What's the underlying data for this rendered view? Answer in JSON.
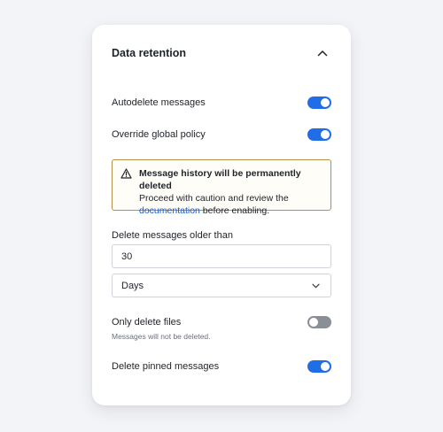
{
  "panel": {
    "title": "Data retention",
    "collapse_icon": "chevron-up-icon"
  },
  "settings": {
    "autodelete": {
      "label": "Autodelete messages",
      "enabled": true
    },
    "override_policy": {
      "label": "Override global policy",
      "enabled": true
    },
    "only_delete_files": {
      "label": "Only delete files",
      "enabled": false,
      "help": "Messages will not be deleted."
    },
    "delete_pinned": {
      "label": "Delete pinned messages",
      "enabled": true
    }
  },
  "warning": {
    "icon": "warning-triangle-icon",
    "title": "Message history will be permanently deleted",
    "body_prefix": "Proceed with caution and review the",
    "link_text": "documentation",
    "body_suffix": " before enabling."
  },
  "retention": {
    "label": "Delete messages older than",
    "value": "30",
    "unit": "Days",
    "unit_icon": "chevron-down-icon"
  },
  "colors": {
    "toggle_on": "#1f6ee8",
    "toggle_off": "#8a8e96",
    "warning_border": "#b7914a",
    "link": "#1a5bc4"
  }
}
